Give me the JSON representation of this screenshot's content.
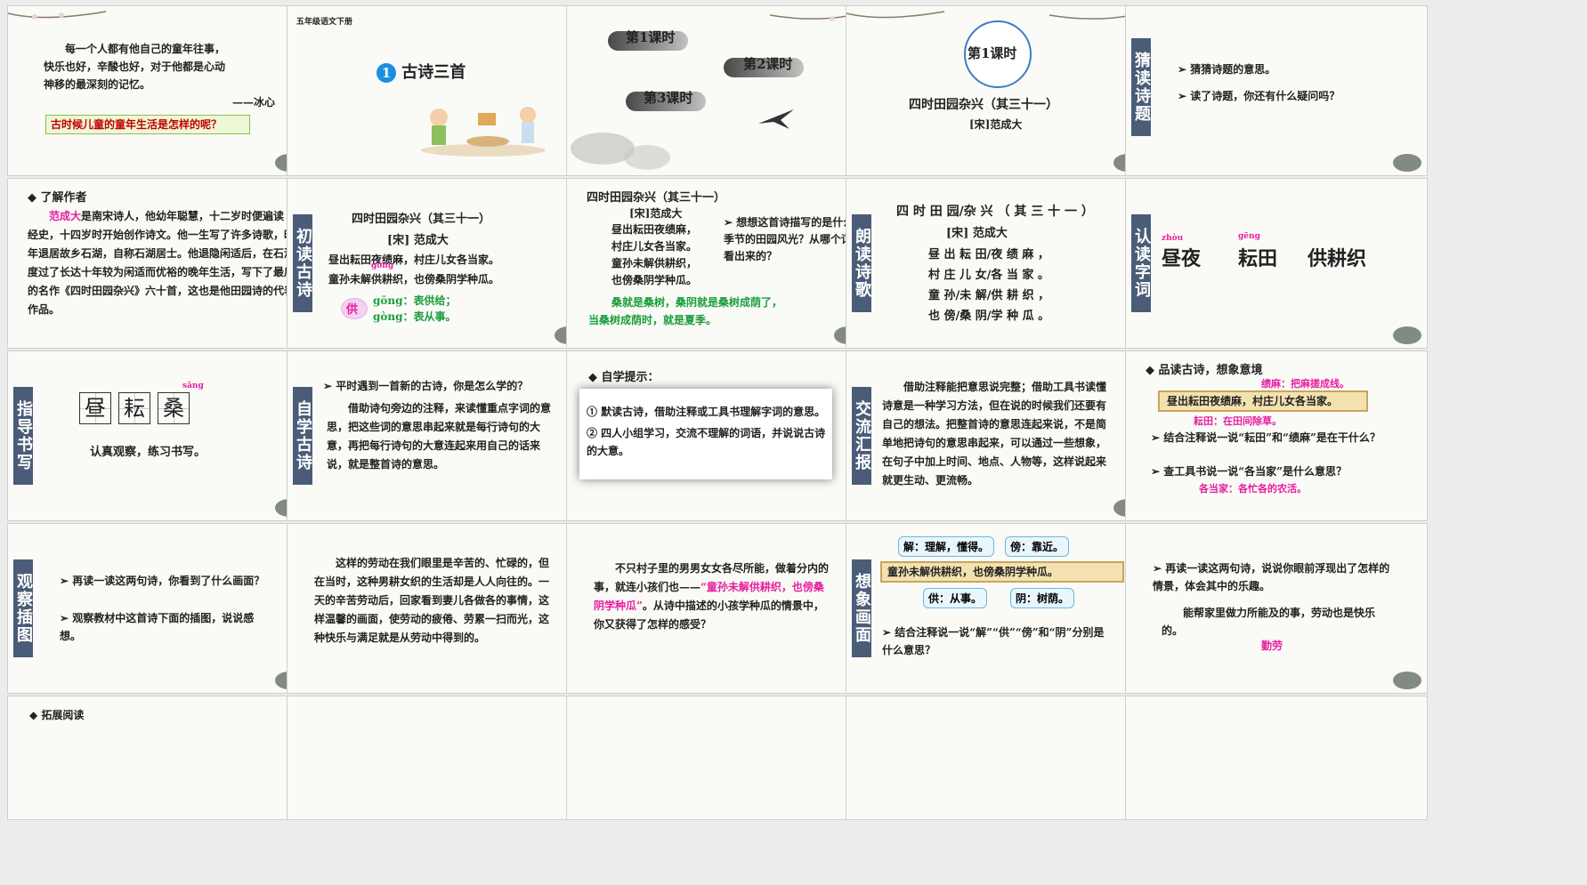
{
  "slides": {
    "s1": {
      "number": "1",
      "line1": "每一个人都有他自己的童年往事，",
      "line2": "快乐也好，辛酸也好，对于他都是心动",
      "line3": "神移的最深刻的记忆。",
      "author": "——冰心",
      "question": "古时候儿童的童年生活是怎样的呢？"
    },
    "s2": {
      "number": "2",
      "grade": "五年级语文下册",
      "lesson_num": "1",
      "lesson_title": "古诗三首"
    },
    "s3": {
      "number": "3",
      "p1": "第1课时",
      "p2": "第2课时",
      "p3": "第3课时"
    },
    "s4": {
      "number": "4",
      "badge": "第1课时",
      "title": "四时田园杂兴（其三十一）",
      "author": "[宋]范成大"
    },
    "s5": {
      "number": "5",
      "label": "猜读诗题",
      "q1": "猜猜诗题的意思。",
      "q2": "读了诗题，你还有什么疑问吗？"
    },
    "s6": {
      "number": "6",
      "heading": "◆ 了解作者",
      "name": "范成大",
      "text": "是南宋诗人，他幼年聪慧，十二岁时便遍读经史，十四岁时开始创作诗文。他一生写了许多诗歌，晚年退居故乡石湖，自称石湖居士。他退隐闲适后，在石湖度过了长达十年较为闲适而优裕的晚年生活，写下了最后的名作《四时田园杂兴》六十首，这也是他田园诗的代表作品。"
    },
    "s7": {
      "number": "7",
      "label": "初读古诗",
      "title": "四时田园杂兴（其三十一）",
      "author": "[宋] 范成大",
      "l1": "昼出耘田夜绩麻，村庄儿女各当家。",
      "l2": "童孙未解供耕织，也傍桑阴学种瓜。",
      "pinyin": "gōng",
      "char": "供",
      "m1": "gōng：表供给；",
      "m2": "gòng：表从事。"
    },
    "s8": {
      "number": "8",
      "title": "四时田园杂兴（其三十一）",
      "author": "[宋]范成大",
      "l1": "昼出耘田夜绩麻，",
      "l2": "村庄儿女各当家。",
      "l3": "童孙未解供耕织，",
      "l4": "也傍桑阴学种瓜。",
      "q": "➢ 想想这首诗描写的是什么季节的田园风光？从哪个词看出来的？",
      "a1": "桑就是桑树，桑阴就是桑树成荫了，",
      "a2": "当桑树成荫时，就是夏季。"
    },
    "s9": {
      "number": "9",
      "label": "朗读诗歌",
      "title": "四 时 田 园/杂 兴 （ 其 三 十 一 ）",
      "author": "[宋] 范成大",
      "l1": "昼 出 耘 田/夜 绩 麻 ，",
      "l2": "村 庄 儿 女/各 当 家 。",
      "l3": "童 孙/未 解/供 耕 织 ，",
      "l4": "也 傍/桑 阴/学 种 瓜 。"
    },
    "s10": {
      "number": "10",
      "label": "认读字词",
      "py1": "zhòu",
      "py2": "gēng",
      "w1": "昼夜",
      "w2": "耘田",
      "w3": "供耕织"
    },
    "s11": {
      "number": "11",
      "label": "指导书写",
      "py": "sāng",
      "c1": "昼",
      "c2": "耘",
      "c3": "桑",
      "caption": "认真观察，练习书写。"
    },
    "s12": {
      "number": "12",
      "label": "自学古诗",
      "q": "➢ 平时遇到一首新的古诗，你是怎么学的？",
      "text": "借助诗句旁边的注释，来读懂重点字词的意思，把这些词的意思串起来就是每行诗句的大意，再把每行诗句的大意连起来用自己的话来说，就是整首诗的意思。"
    },
    "s13": {
      "number": "13",
      "heading": "◆ 自学提示：",
      "t1": "① 默读古诗，借助注释或工具书理解字词的意思。",
      "t2": "② 四人小组学习，交流不理解的词语，并说说古诗的大意。"
    },
    "s14": {
      "number": "14",
      "label": "交流汇报",
      "text": "借助注释能把意思说完整；借助工具书读懂诗意是一种学习方法，但在说的时候我们还要有自己的想法。把整首诗的意思连起来说，不是简单地把诗句的意思串起来，可以通过一些想象，在句子中加上时间、地点、人物等，这样说起来就更生动、更流畅。"
    },
    "s15": {
      "number": "15",
      "heading": "◆ 品读古诗，想象意境",
      "jm": "绩麻：把麻搓成线。",
      "line": "昼出耘田夜绩麻，村庄儿女各当家。",
      "yt": "耘田：在田间除草。",
      "q1": "➢ 结合注释说一说“耘田”和“绩麻”是在干什么？",
      "q2": "➢ 查工具书说一说“各当家”是什么意思？",
      "a": "各当家：各忙各的农活。"
    },
    "s16": {
      "number": "16",
      "label": "观察插图",
      "q1": "➢ 再读一读这两句诗，你看到了什么画面？",
      "q2": "➢ 观察教材中这首诗下面的插图，说说感想。"
    },
    "s17": {
      "number": "17",
      "text": "这样的劳动在我们眼里是辛苦的、忙碌的，但在当时，这种男耕女织的生活却是人人向往的。一天的辛苦劳动后，回家看到妻儿各做各的事情，这样温馨的画面，使劳动的疲倦、劳累一扫而光，这种快乐与满足就是从劳动中得到的。"
    },
    "s18": {
      "number": "18",
      "t1": "不只村子里的男男女女各尽所能，做着分内的事，就连小孩们也——",
      "quote": "“童孙未解供耕织，也傍桑阴学种瓜”",
      "t2": "。从诗中描述的小孩学种瓜的情景中，你又获得了怎样的感受？"
    },
    "s19": {
      "number": "19",
      "label": "想象画面",
      "b1": "解：理解，懂得。",
      "b2": "傍：靠近。",
      "line": "童孙未解供耕织，也傍桑阴学种瓜。",
      "b3": "供：从事。",
      "b4": "阴：树荫。",
      "q": "➢ 结合注释说一说“解”“供”“傍”和“阴”分别是什么意思？"
    },
    "s20": {
      "number": "20",
      "q": "➢ 再读一读这两句诗，说说你眼前浮现出了怎样的情景，体会其中的乐趣。",
      "text": "能帮家里做力所能及的事，劳动也是快乐的。",
      "key": "勤劳"
    }
  },
  "next_row_hint": "◆ 拓展阅读",
  "colors": {
    "label_bg": "#4a5c78",
    "pink": "#e61ea0",
    "green": "#1a9e3a",
    "selected": "#f0a300"
  }
}
